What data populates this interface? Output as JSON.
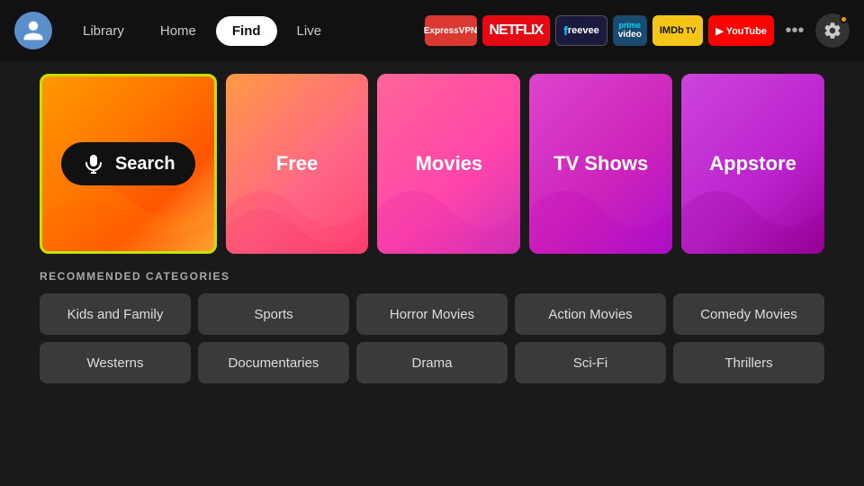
{
  "navbar": {
    "nav_items": [
      {
        "id": "library",
        "label": "Library",
        "active": false
      },
      {
        "id": "home",
        "label": "Home",
        "active": false
      },
      {
        "id": "find",
        "label": "Find",
        "active": true
      },
      {
        "id": "live",
        "label": "Live",
        "active": false
      }
    ],
    "apps": [
      {
        "id": "expressvpn",
        "label": "ExpressVPN"
      },
      {
        "id": "netflix",
        "label": "NETFLIX"
      },
      {
        "id": "freevee",
        "label": "freevee"
      },
      {
        "id": "primevideo",
        "label": "prime video"
      },
      {
        "id": "imdb",
        "label": "IMDb TV"
      },
      {
        "id": "youtube",
        "label": "▶ YouTube"
      }
    ],
    "more_label": "•••",
    "settings_label": "⚙"
  },
  "tiles": [
    {
      "id": "search",
      "label": "Search",
      "type": "search"
    },
    {
      "id": "free",
      "label": "Free",
      "type": "free"
    },
    {
      "id": "movies",
      "label": "Movies",
      "type": "movies"
    },
    {
      "id": "tvshows",
      "label": "TV Shows",
      "type": "tvshows"
    },
    {
      "id": "appstore",
      "label": "Appstore",
      "type": "appstore"
    }
  ],
  "recommended": {
    "section_title": "RECOMMENDED CATEGORIES",
    "rows": [
      [
        "Kids and Family",
        "Sports",
        "Horror Movies",
        "Action Movies",
        "Comedy Movies"
      ],
      [
        "Westerns",
        "Documentaries",
        "Drama",
        "Sci-Fi",
        "Thrillers"
      ]
    ]
  }
}
